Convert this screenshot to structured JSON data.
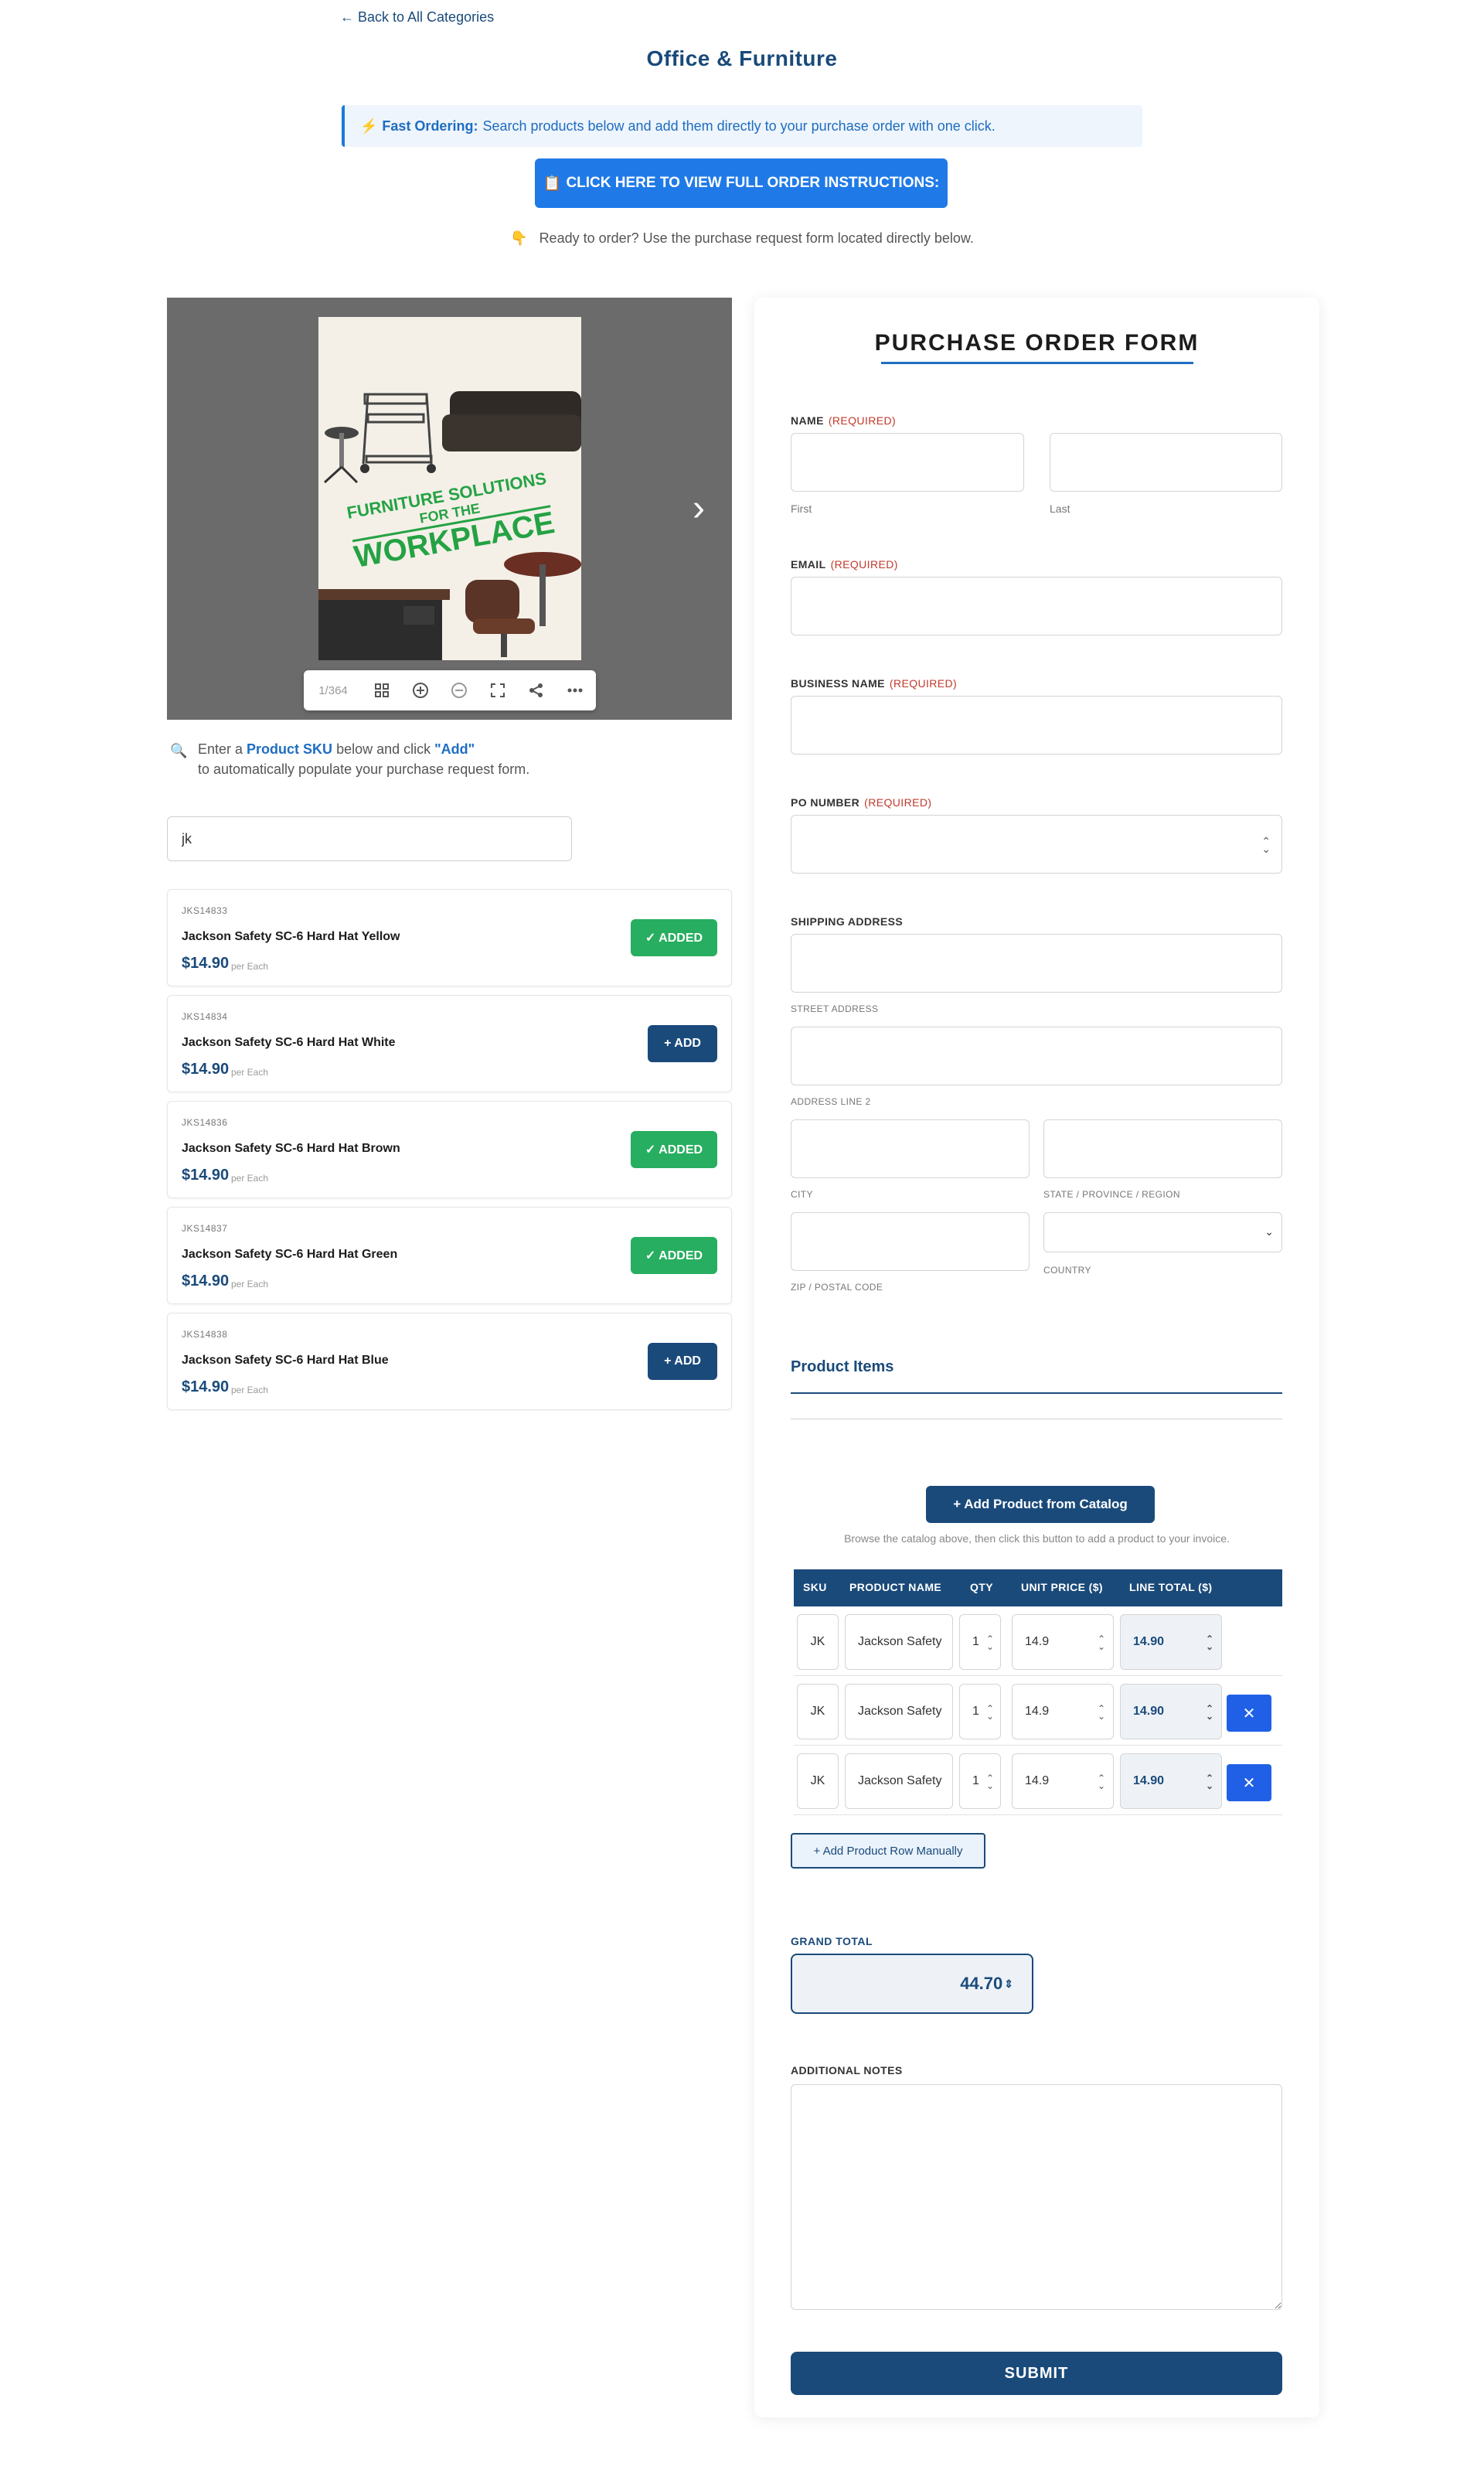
{
  "header": {
    "back_link": "← Back to All Categories",
    "title": "Office & Furniture",
    "banner_label": "Fast Ordering:",
    "banner_text": "Search products below and add them directly to your purchase order with one click.",
    "cta_button": "CLICK HERE TO VIEW FULL ORDER INSTRUCTIONS:",
    "ready_text": "Ready to order? Use the purchase request form located directly below."
  },
  "viewer": {
    "cover_line1": "FURNITURE SOLUTIONS",
    "cover_line2": "FOR THE",
    "cover_line3": "WORKPLACE",
    "page_counter": "1/364"
  },
  "hint": {
    "pre": "Enter a ",
    "sku": "Product SKU",
    "mid": " below and click ",
    "add": "\"Add\"",
    "post": "to automatically populate your purchase request form."
  },
  "search": {
    "value": "jk"
  },
  "products": [
    {
      "sku": "JKS14833",
      "name": "Jackson Safety SC-6 Hard Hat Yellow",
      "price": "$14.90",
      "unit": "per Each",
      "button": "✓ ADDED"
    },
    {
      "sku": "JKS14834",
      "name": "Jackson Safety SC-6 Hard Hat White",
      "price": "$14.90",
      "unit": "per Each",
      "button": "+ ADD"
    },
    {
      "sku": "JKS14836",
      "name": "Jackson Safety SC-6 Hard Hat Brown",
      "price": "$14.90",
      "unit": "per Each",
      "button": "✓ ADDED"
    },
    {
      "sku": "JKS14837",
      "name": "Jackson Safety SC-6 Hard Hat Green",
      "price": "$14.90",
      "unit": "per Each",
      "button": "✓ ADDED"
    },
    {
      "sku": "JKS14838",
      "name": "Jackson Safety SC-6 Hard Hat Blue",
      "price": "$14.90",
      "unit": "per Each",
      "button": "+ ADD"
    }
  ],
  "form": {
    "title": "PURCHASE ORDER FORM",
    "required": "(REQUIRED)",
    "name_label": "NAME",
    "first": "First",
    "last": "Last",
    "email_label": "EMAIL",
    "business_label": "BUSINESS NAME",
    "po_label": "PO NUMBER",
    "shipping_label": "SHIPPING ADDRESS",
    "street": "STREET ADDRESS",
    "line2": "ADDRESS LINE 2",
    "city": "CITY",
    "state": "STATE / PROVINCE / REGION",
    "zip": "ZIP / POSTAL CODE",
    "country": "COUNTRY",
    "product_items": "Product Items",
    "catalog_button": "+ Add Product from Catalog",
    "catalog_hint": "Browse the catalog above, then click this button to add a product to your invoice.",
    "table_headers": [
      "SKU",
      "PRODUCT NAME",
      "QTY",
      "UNIT PRICE ($)",
      "LINE TOTAL ($)"
    ],
    "rows": [
      {
        "sku": "JK",
        "name": "Jackson Safety",
        "qty": "1",
        "unit": "14.9",
        "total": "14.90"
      },
      {
        "sku": "JK",
        "name": "Jackson Safety",
        "qty": "1",
        "unit": "14.9",
        "total": "14.90"
      },
      {
        "sku": "JK",
        "name": "Jackson Safety",
        "qty": "1",
        "unit": "14.9",
        "total": "14.90"
      }
    ],
    "manual_button": "+ Add Product Row Manually",
    "grand_label": "GRAND TOTAL",
    "grand_value": "44.70",
    "notes_label": "ADDITIONAL NOTES",
    "submit": "SUBMIT"
  }
}
